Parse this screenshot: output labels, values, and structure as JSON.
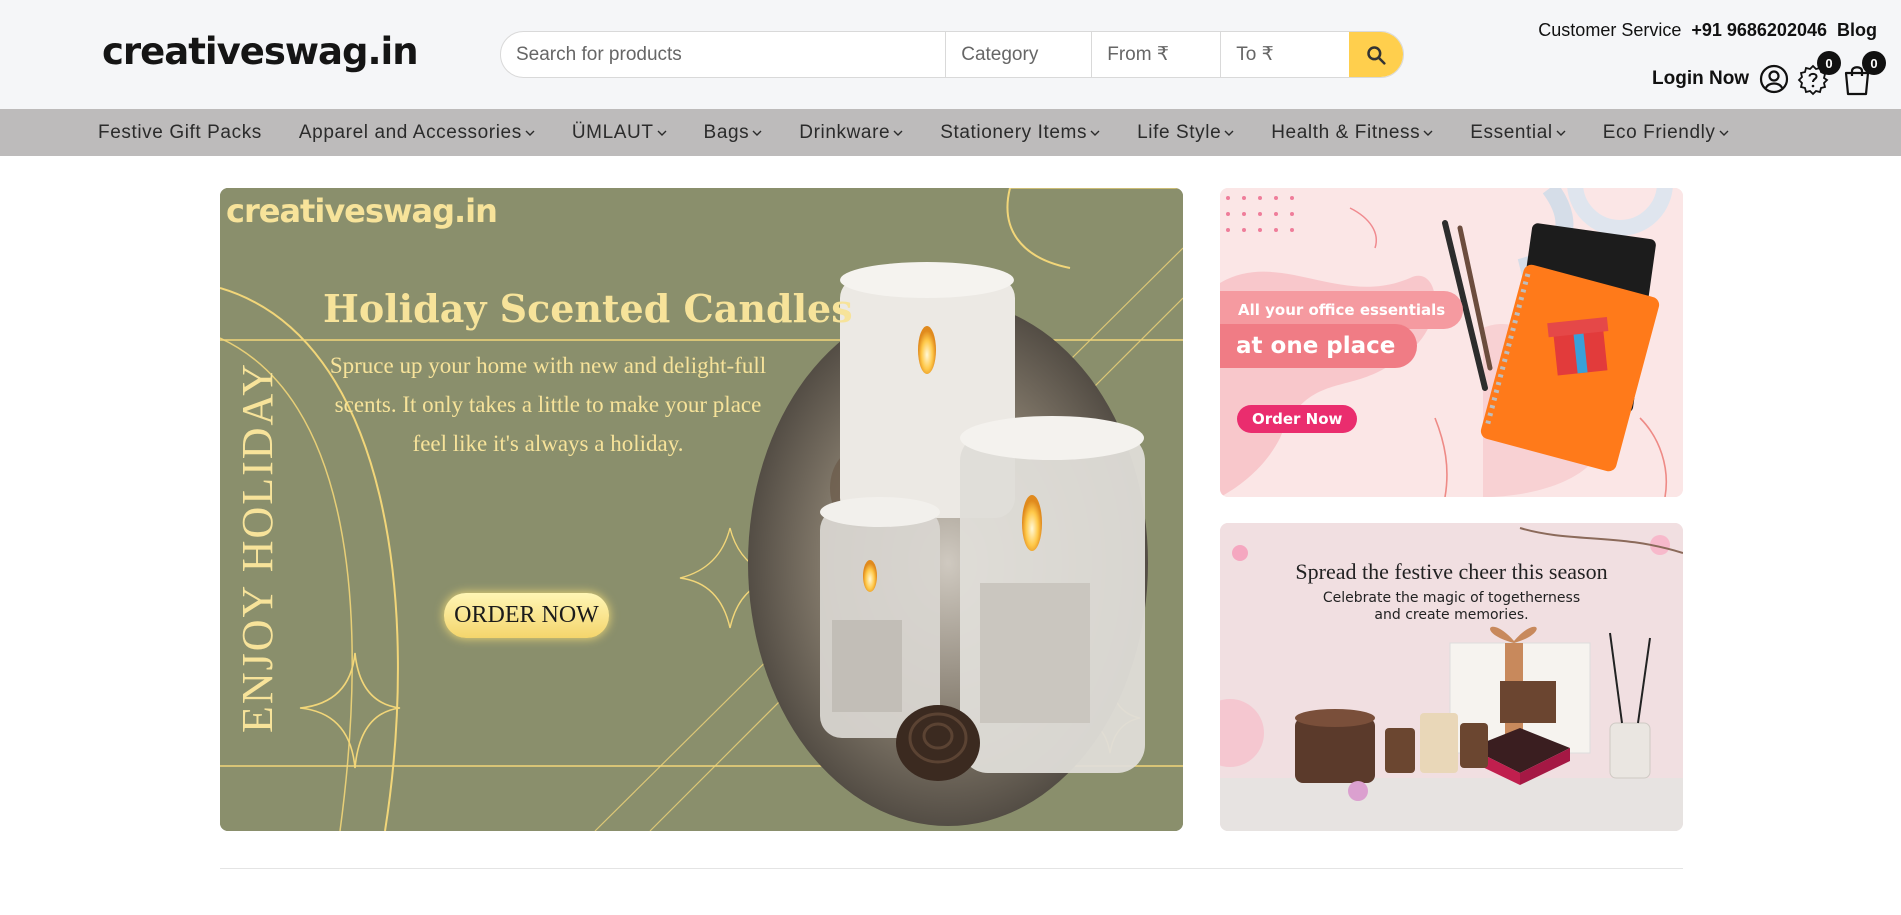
{
  "header": {
    "logo": "creativeswag.in",
    "search": {
      "placeholder": "Search for products",
      "category_placeholder": "Category",
      "from_placeholder": "From ₹",
      "to_placeholder": "To ₹"
    },
    "top_links": {
      "customer_service": "Customer Service",
      "phone": "+91 9686202046",
      "blog": "Blog"
    },
    "login_label": "Login Now",
    "wishlist_count": "0",
    "cart_count": "0"
  },
  "nav": {
    "items": [
      {
        "label": "Festive Gift Packs",
        "dropdown": false
      },
      {
        "label": "Apparel and Accessories",
        "dropdown": true
      },
      {
        "label": "ÜMLAUT",
        "dropdown": true
      },
      {
        "label": "Bags",
        "dropdown": true
      },
      {
        "label": "Drinkware",
        "dropdown": true
      },
      {
        "label": "Stationery Items",
        "dropdown": true
      },
      {
        "label": "Life Style",
        "dropdown": true
      },
      {
        "label": "Health & Fitness",
        "dropdown": true
      },
      {
        "label": "Essential",
        "dropdown": true
      },
      {
        "label": "Eco Friendly",
        "dropdown": true
      }
    ]
  },
  "hero": {
    "logo": "creativeswag.in",
    "title": "Holiday Scented Candles",
    "subtitle": "Spruce up your home with new and delight-full scents. It only takes a little to make your place feel like it's always a holiday.",
    "vertical_text": "ENJOY HOLIDAY",
    "button": "ORDER NOW"
  },
  "side_banner_1": {
    "line1": "All your office essentials",
    "line2": "at one place",
    "button": "Order Now"
  },
  "side_banner_2": {
    "title": "Spread the festive cheer this season",
    "subtitle_line1": "Celebrate the magic of togetherness",
    "subtitle_line2": "and create memories."
  },
  "colors": {
    "accent": "#ffcf4d",
    "nav_bg": "#bdbbbb",
    "hero_bg": "#8a8f6c",
    "hero_text": "#f7e39a",
    "pink": "#ea2d6e"
  }
}
